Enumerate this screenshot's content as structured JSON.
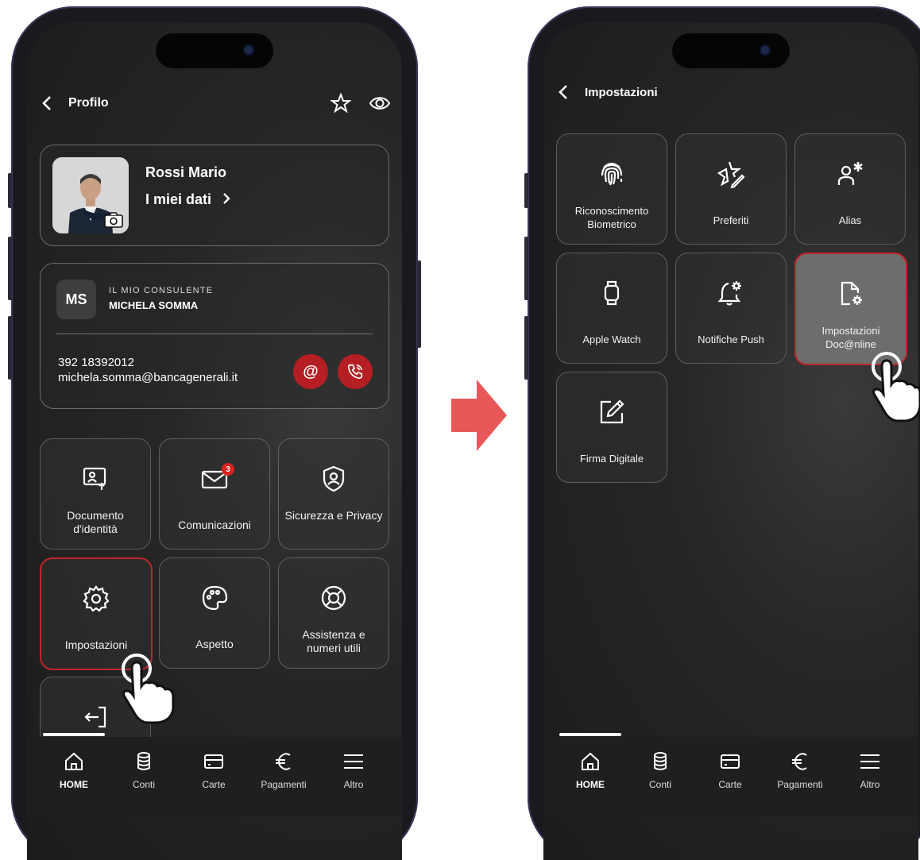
{
  "left_screen": {
    "header": {
      "title": "Profilo"
    },
    "profile": {
      "name": "Rossi Mario",
      "my_data_label": "I miei dati"
    },
    "consultant": {
      "initials": "MS",
      "label": "IL MIO CONSULENTE",
      "name": "MICHELA SOMMA",
      "phone": "392 18392012",
      "email": "michela.somma@bancagenerali.it"
    },
    "tiles": [
      {
        "label": "Documento d'identità",
        "icon": "id-document-icon"
      },
      {
        "label": "Comunicazioni",
        "icon": "mail-icon",
        "badge": "3"
      },
      {
        "label": "Sicurezza e Privacy",
        "icon": "shield-user-icon"
      },
      {
        "label": "Impostazioni",
        "icon": "gear-icon"
      },
      {
        "label": "Aspetto",
        "icon": "palette-icon"
      },
      {
        "label": "Assistenza e numeri utili",
        "icon": "lifebuoy-icon"
      },
      {
        "label": "",
        "icon": "logout-icon"
      }
    ]
  },
  "right_screen": {
    "header": {
      "title": "Impostazioni"
    },
    "tiles": [
      {
        "label": "Riconoscimento Biometrico",
        "icon": "fingerprint-icon"
      },
      {
        "label": "Preferiti",
        "icon": "star-edit-icon"
      },
      {
        "label": "Alias",
        "icon": "user-asterisk-icon"
      },
      {
        "label": "Apple Watch",
        "icon": "watch-icon"
      },
      {
        "label": "Notifiche Push",
        "icon": "bell-gear-icon"
      },
      {
        "label": "Impostazioni Doc@nline",
        "icon": "document-gear-icon"
      },
      {
        "label": "Firma Digitale",
        "icon": "sign-edit-icon"
      }
    ]
  },
  "nav": {
    "items": [
      {
        "label": "HOME",
        "icon": "home-icon"
      },
      {
        "label": "Conti",
        "icon": "coins-icon"
      },
      {
        "label": "Carte",
        "icon": "card-icon"
      },
      {
        "label": "Pagamenti",
        "icon": "euro-icon"
      },
      {
        "label": "Altro",
        "icon": "menu-icon"
      }
    ]
  },
  "colors": {
    "accent_red": "#b51e22",
    "background": "#262626"
  }
}
